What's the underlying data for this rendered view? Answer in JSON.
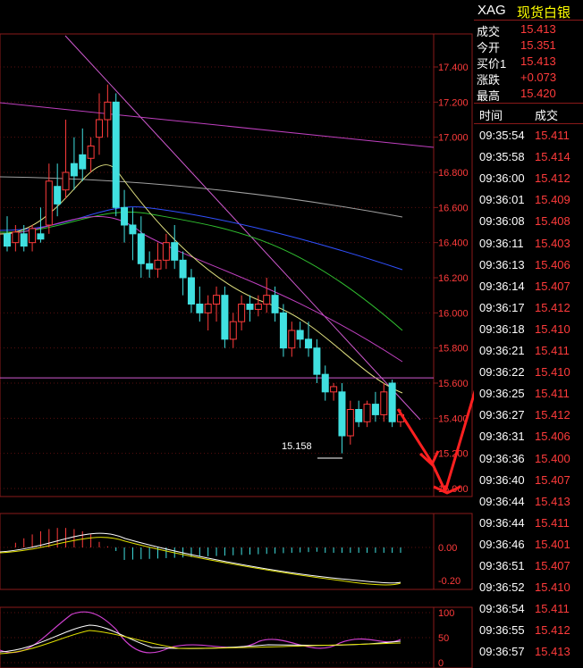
{
  "header": {
    "symbol": "XAG",
    "name": "现货白银"
  },
  "quote": [
    {
      "label": "成交",
      "value": "15.413"
    },
    {
      "label": "今开",
      "value": "15.351"
    },
    {
      "label": "买价1",
      "value": "15.413"
    },
    {
      "label": "涨跌",
      "value": "+0.073"
    },
    {
      "label": "最高",
      "value": "15.420"
    }
  ],
  "trades_header": {
    "time": "时间",
    "price": "成交"
  },
  "trades": [
    {
      "time": "09:35:54",
      "price": "15.411"
    },
    {
      "time": "09:35:58",
      "price": "15.414"
    },
    {
      "time": "09:36:00",
      "price": "15.412"
    },
    {
      "time": "09:36:01",
      "price": "15.409"
    },
    {
      "time": "09:36:08",
      "price": "15.408"
    },
    {
      "time": "09:36:11",
      "price": "15.403"
    },
    {
      "time": "09:36:13",
      "price": "15.406"
    },
    {
      "time": "09:36:14",
      "price": "15.407"
    },
    {
      "time": "09:36:17",
      "price": "15.412"
    },
    {
      "time": "09:36:18",
      "price": "15.410"
    },
    {
      "time": "09:36:21",
      "price": "15.411"
    },
    {
      "time": "09:36:22",
      "price": "15.410"
    },
    {
      "time": "09:36:25",
      "price": "15.411"
    },
    {
      "time": "09:36:27",
      "price": "15.412"
    },
    {
      "time": "09:36:31",
      "price": "15.406"
    },
    {
      "time": "09:36:36",
      "price": "15.400"
    },
    {
      "time": "09:36:40",
      "price": "15.407"
    },
    {
      "time": "09:36:44",
      "price": "15.413"
    },
    {
      "time": "09:36:44",
      "price": "15.411"
    },
    {
      "time": "09:36:46",
      "price": "15.401"
    },
    {
      "time": "09:36:51",
      "price": "15.407"
    },
    {
      "time": "09:36:52",
      "price": "15.410"
    },
    {
      "time": "09:36:54",
      "price": "15.411"
    },
    {
      "time": "09:36:55",
      "price": "15.412"
    },
    {
      "time": "09:36:57",
      "price": "15.413"
    }
  ],
  "chart_data": {
    "type": "candlestick",
    "price_axis": {
      "ticks": [
        17.4,
        17.2,
        17.0,
        16.8,
        16.6,
        16.4,
        16.2,
        16.0,
        15.8,
        15.6,
        15.4,
        15.2,
        15.0
      ],
      "tick_labels": [
        "17.400",
        "17.200",
        "17.000",
        "16.800",
        "16.600",
        "16.400",
        "16.200",
        "16.000",
        "15.800",
        "15.600",
        "15.400",
        "15.200",
        "15.000"
      ],
      "range": [
        14.95,
        17.6
      ]
    },
    "annotation": {
      "text": "15.158",
      "value": 15.158
    },
    "reference_line": 15.63,
    "candles": [
      {
        "o": 16.45,
        "h": 16.55,
        "l": 16.35,
        "c": 16.38
      },
      {
        "o": 16.4,
        "h": 16.5,
        "l": 16.35,
        "c": 16.46
      },
      {
        "o": 16.45,
        "h": 16.5,
        "l": 16.35,
        "c": 16.38
      },
      {
        "o": 16.4,
        "h": 16.5,
        "l": 16.35,
        "c": 16.48
      },
      {
        "o": 16.45,
        "h": 16.6,
        "l": 16.4,
        "c": 16.42
      },
      {
        "o": 16.5,
        "h": 16.85,
        "l": 16.45,
        "c": 16.75
      },
      {
        "o": 16.72,
        "h": 16.85,
        "l": 16.55,
        "c": 16.62
      },
      {
        "o": 16.7,
        "h": 17.1,
        "l": 16.65,
        "c": 16.8
      },
      {
        "o": 16.85,
        "h": 17.0,
        "l": 16.7,
        "c": 16.78
      },
      {
        "o": 16.9,
        "h": 17.05,
        "l": 16.75,
        "c": 16.82
      },
      {
        "o": 16.88,
        "h": 17.0,
        "l": 16.8,
        "c": 16.95
      },
      {
        "o": 17.0,
        "h": 17.25,
        "l": 16.9,
        "c": 17.1
      },
      {
        "o": 17.1,
        "h": 17.3,
        "l": 17.0,
        "c": 17.2
      },
      {
        "o": 17.2,
        "h": 17.25,
        "l": 16.55,
        "c": 16.6
      },
      {
        "o": 16.6,
        "h": 16.7,
        "l": 16.4,
        "c": 16.5
      },
      {
        "o": 16.5,
        "h": 16.6,
        "l": 16.3,
        "c": 16.45
      },
      {
        "o": 16.45,
        "h": 16.55,
        "l": 16.2,
        "c": 16.28
      },
      {
        "o": 16.28,
        "h": 16.35,
        "l": 16.2,
        "c": 16.25
      },
      {
        "o": 16.25,
        "h": 16.4,
        "l": 16.2,
        "c": 16.3
      },
      {
        "o": 16.3,
        "h": 16.45,
        "l": 16.25,
        "c": 16.4
      },
      {
        "o": 16.4,
        "h": 16.5,
        "l": 16.25,
        "c": 16.3
      },
      {
        "o": 16.3,
        "h": 16.35,
        "l": 16.1,
        "c": 16.2
      },
      {
        "o": 16.2,
        "h": 16.25,
        "l": 16.0,
        "c": 16.05
      },
      {
        "o": 16.05,
        "h": 16.15,
        "l": 15.95,
        "c": 16.0
      },
      {
        "o": 16.0,
        "h": 16.1,
        "l": 15.9,
        "c": 16.05
      },
      {
        "o": 16.05,
        "h": 16.15,
        "l": 15.95,
        "c": 16.1
      },
      {
        "o": 16.1,
        "h": 16.15,
        "l": 15.8,
        "c": 15.85
      },
      {
        "o": 15.85,
        "h": 16.0,
        "l": 15.8,
        "c": 15.95
      },
      {
        "o": 15.95,
        "h": 16.1,
        "l": 15.9,
        "c": 16.05
      },
      {
        "o": 16.05,
        "h": 16.1,
        "l": 15.95,
        "c": 16.02
      },
      {
        "o": 16.02,
        "h": 16.1,
        "l": 15.98,
        "c": 16.05
      },
      {
        "o": 16.05,
        "h": 16.2,
        "l": 16.0,
        "c": 16.1
      },
      {
        "o": 16.1,
        "h": 16.15,
        "l": 15.95,
        "c": 16.0
      },
      {
        "o": 16.0,
        "h": 16.05,
        "l": 15.75,
        "c": 15.8
      },
      {
        "o": 15.8,
        "h": 15.95,
        "l": 15.75,
        "c": 15.9
      },
      {
        "o": 15.9,
        "h": 15.95,
        "l": 15.8,
        "c": 15.85
      },
      {
        "o": 15.85,
        "h": 15.95,
        "l": 15.75,
        "c": 15.8
      },
      {
        "o": 15.8,
        "h": 15.85,
        "l": 15.6,
        "c": 15.65
      },
      {
        "o": 15.65,
        "h": 15.7,
        "l": 15.5,
        "c": 15.55
      },
      {
        "o": 15.55,
        "h": 15.6,
        "l": 15.5,
        "c": 15.58
      },
      {
        "o": 15.55,
        "h": 15.6,
        "l": 15.2,
        "c": 15.3
      },
      {
        "o": 15.3,
        "h": 15.5,
        "l": 15.25,
        "c": 15.45
      },
      {
        "o": 15.45,
        "h": 15.5,
        "l": 15.35,
        "c": 15.38
      },
      {
        "o": 15.38,
        "h": 15.5,
        "l": 15.35,
        "c": 15.48
      },
      {
        "o": 15.48,
        "h": 15.55,
        "l": 15.38,
        "c": 15.42
      },
      {
        "o": 15.42,
        "h": 15.6,
        "l": 15.38,
        "c": 15.55
      },
      {
        "o": 15.6,
        "h": 15.62,
        "l": 15.35,
        "c": 15.38
      },
      {
        "o": 15.38,
        "h": 15.45,
        "l": 15.35,
        "c": 15.42
      }
    ],
    "macd_axis": {
      "tick_labels": [
        "0.00",
        "-0.20"
      ]
    },
    "kdj_axis": {
      "tick_labels": [
        "100",
        "50",
        "0"
      ]
    }
  }
}
